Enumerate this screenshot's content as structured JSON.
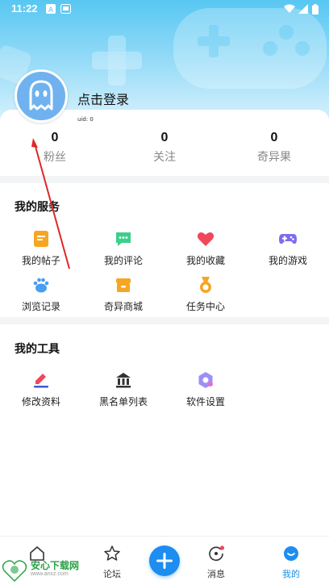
{
  "status_bar": {
    "time": "11:22"
  },
  "profile": {
    "login_text": "点击登录",
    "uid": "uid: 0"
  },
  "stats": [
    {
      "value": "0",
      "label": "粉丝"
    },
    {
      "value": "0",
      "label": "关注"
    },
    {
      "value": "0",
      "label": "奇异果"
    }
  ],
  "services": {
    "title": "我的服务",
    "items": [
      {
        "label": "我的帖子",
        "icon": "posts-icon",
        "color": "#f5a623"
      },
      {
        "label": "我的评论",
        "icon": "comment-icon",
        "color": "#3ccf8e"
      },
      {
        "label": "我的收藏",
        "icon": "heart-icon",
        "color": "#f0475a"
      },
      {
        "label": "我的游戏",
        "icon": "gamepad-icon",
        "color": "#7c6cf2"
      },
      {
        "label": "浏览记录",
        "icon": "paw-icon",
        "color": "#4a9df0"
      },
      {
        "label": "奇异商城",
        "icon": "shop-icon",
        "color": "#f5a623"
      },
      {
        "label": "任务中心",
        "icon": "medal-icon",
        "color": "#f5a623"
      }
    ]
  },
  "tools": {
    "title": "我的工具",
    "items": [
      {
        "label": "修改资料",
        "icon": "edit-icon",
        "color": "#3b5bd6"
      },
      {
        "label": "黑名单列表",
        "icon": "blacklist-icon",
        "color": "#333333"
      },
      {
        "label": "软件设置",
        "icon": "settings-icon",
        "color": "#7c6cf2"
      }
    ]
  },
  "tabbar": [
    {
      "label": "",
      "icon": "home-icon"
    },
    {
      "label": "论坛",
      "icon": "star-icon"
    },
    {
      "label": "",
      "icon": "plus-icon"
    },
    {
      "label": "消息",
      "icon": "message-icon"
    },
    {
      "label": "我的",
      "icon": "profile-icon",
      "active": true
    }
  ],
  "watermark": {
    "name": "安心下载网",
    "url": "www.anxz.com"
  },
  "colors": {
    "accent": "#1d8df0",
    "header_top": "#57c7f2"
  }
}
